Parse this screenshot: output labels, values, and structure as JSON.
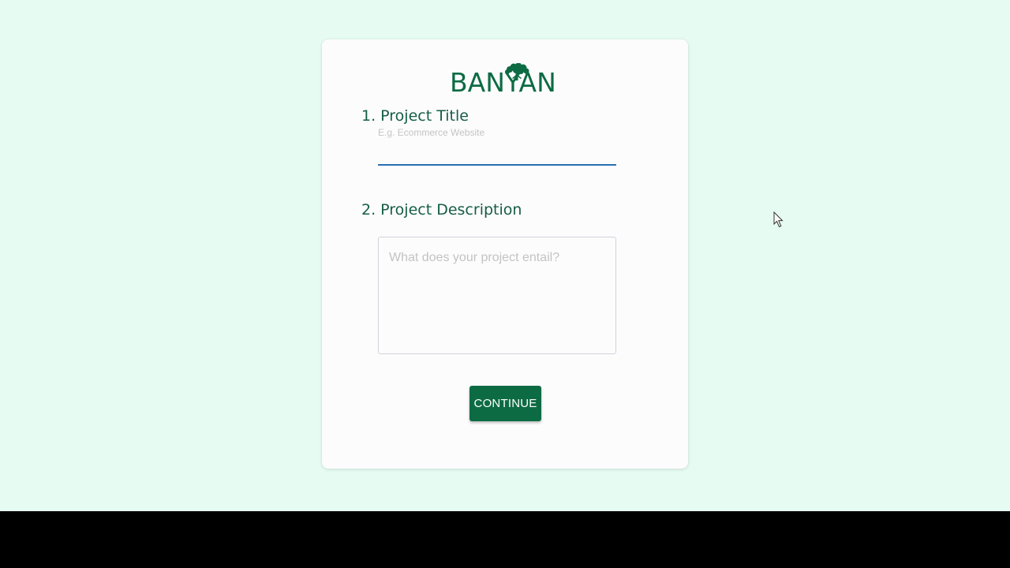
{
  "brand": {
    "name": "BANYAN",
    "color": "#0d6b43"
  },
  "form": {
    "title_label": "1. Project Title",
    "title_placeholder": "E.g. Ecommerce Website",
    "title_value": "",
    "description_label": "2. Project Description",
    "description_placeholder": "What does your project entail?",
    "description_value": "",
    "continue_label": "CONTINUE"
  },
  "icons": {
    "logo": "tree-icon",
    "pointer": "mouse-cursor-icon"
  },
  "colors": {
    "background": "#e6fbf2",
    "card": "#fcfcfd",
    "label": "#165d45",
    "input_underline": "#2a6fb0",
    "button": "#0d6b43"
  }
}
